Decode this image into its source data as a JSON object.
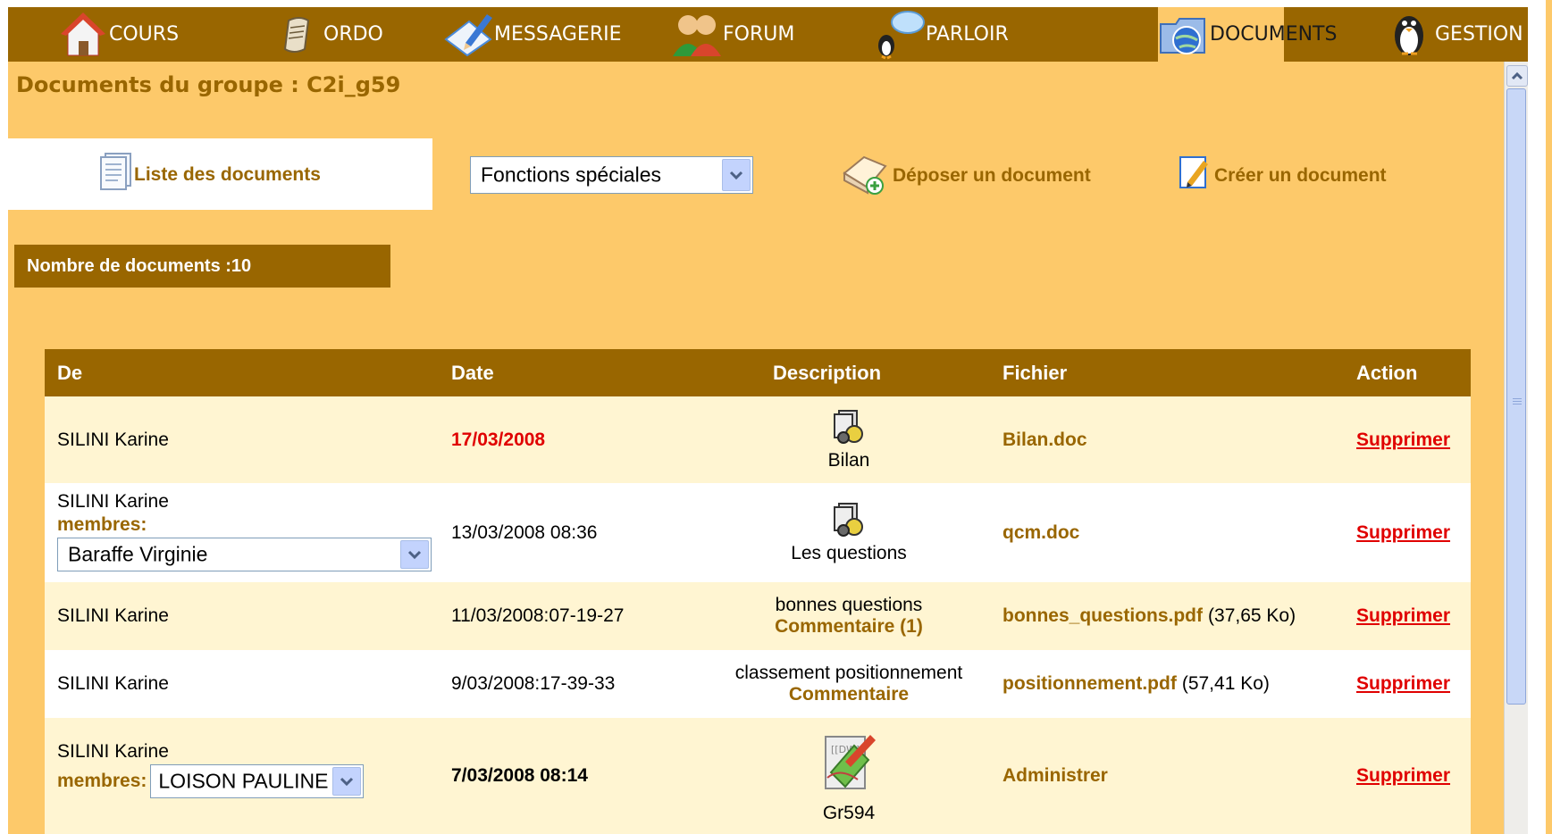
{
  "nav": {
    "tabs": [
      {
        "label": "COURS",
        "icon": "house-icon"
      },
      {
        "label": "ORDO",
        "icon": "scroll-icon"
      },
      {
        "label": "MESSAGERIE",
        "icon": "pencil-paper-icon"
      },
      {
        "label": "FORUM",
        "icon": "people-icon"
      },
      {
        "label": "PARLOIR",
        "icon": "speech-penguin-icon"
      },
      {
        "label": "DOCUMENTS",
        "icon": "folder-globe-icon"
      },
      {
        "label": "GESTION",
        "icon": "penguin-icon"
      }
    ],
    "active": "DOCUMENTS"
  },
  "page": {
    "title": "Documents du groupe : C2i_g59"
  },
  "subnav": {
    "list_label": "Liste des documents",
    "select_value": "Fonctions spéciales",
    "deposit_label": "Déposer un document",
    "create_label": "Créer un document"
  },
  "count_label": "Nombre de documents :10",
  "table": {
    "headers": {
      "from": "De",
      "date": "Date",
      "description": "Description",
      "file": "Fichier",
      "action": "Action"
    },
    "rows": [
      {
        "from": "SILINI Karine",
        "date": "17/03/2008",
        "desc": "Bilan",
        "file": "Bilan.doc",
        "action": "Supprimer"
      },
      {
        "from": "SILINI Karine",
        "members_label": "membres:",
        "member": "Baraffe Virginie",
        "date": "13/03/2008 08:36",
        "desc": "Les questions",
        "file": "qcm.doc",
        "action": "Supprimer"
      },
      {
        "from": "SILINI Karine",
        "date": "11/03/2008:07-19-27",
        "desc": "bonnes questions",
        "comment": "Commentaire (1)",
        "file": "bonnes_questions.pdf",
        "size": "(37,65 Ko)",
        "action": "Supprimer"
      },
      {
        "from": "SILINI Karine",
        "date": "9/03/2008:17-39-33",
        "desc": "classement positionnement",
        "comment": "Commentaire",
        "file": "positionnement.pdf",
        "size": "(57,41 Ko)",
        "action": "Supprimer"
      },
      {
        "from": "SILINI Karine",
        "members_label": "membres:",
        "member": "LOISON PAULINE",
        "date": "7/03/2008 08:14",
        "desc": "Gr594",
        "file": "Administrer",
        "action": "Supprimer"
      }
    ]
  },
  "colors": {
    "brand": "#996600",
    "background": "#fdc96a",
    "row_alt": "#fff5d2",
    "link_red": "#e00000"
  }
}
